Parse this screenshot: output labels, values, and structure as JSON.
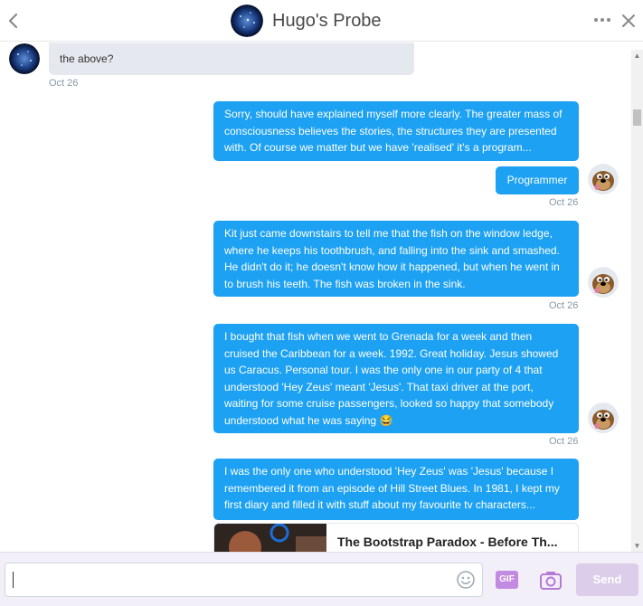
{
  "header": {
    "title": "Hugo's Probe"
  },
  "messages": {
    "incoming_1": {
      "text": "the above?",
      "time": "Oct 26"
    },
    "out_1": {
      "text": "Sorry, should have explained myself more clearly. The greater mass of consciousness believes the stories, the structures they are presented with. Of course we matter but we have 'realised' it's a program..."
    },
    "out_2": {
      "text": "Programmer",
      "time": "Oct 26"
    },
    "out_3": {
      "text": "Kit just came downstairs to tell me that the fish on the window ledge, where he keeps his toothbrush, and falling into the sink and smashed. He didn't do it; he doesn't know how it happened, but when he went in to brush his teeth. The fish was broken in the sink.",
      "time": "Oct 26"
    },
    "out_4": {
      "text": "I bought that fish when we went to Grenada for a week and then cruised the Caribbean for a week. 1992. Great holiday. Jesus showed us Caracus. Personal tour. I was the only one in our party of 4 that understood 'Hey Zeus' meant 'Jesus'. That taxi driver at the port, waiting for some cruise passengers, looked so happy that somebody understood what he was saying 😂",
      "time": "Oct 26"
    },
    "out_5": {
      "text": "I was the only one who understood 'Hey Zeus' was 'Jesus' because I remembered it from an episode of Hill Street Blues. In 1981, I kept my first diary and filled it with stuff about my favourite tv characters..."
    },
    "link_card": {
      "title": "The Bootstrap Paradox - Before Th..."
    }
  },
  "composer": {
    "placeholder": "",
    "gif_label": "GIF",
    "send_label": "Send"
  },
  "icons": {
    "back": "chevron-left-icon",
    "more": "more-horizontal-icon",
    "close": "close-icon",
    "emoji": "emoji-icon",
    "camera": "camera-icon"
  },
  "colors": {
    "outgoing_bubble": "#1da1f2",
    "incoming_bubble": "#e5e8ee",
    "composer_bg": "#f3eff9",
    "accent": "#b57ad6"
  }
}
